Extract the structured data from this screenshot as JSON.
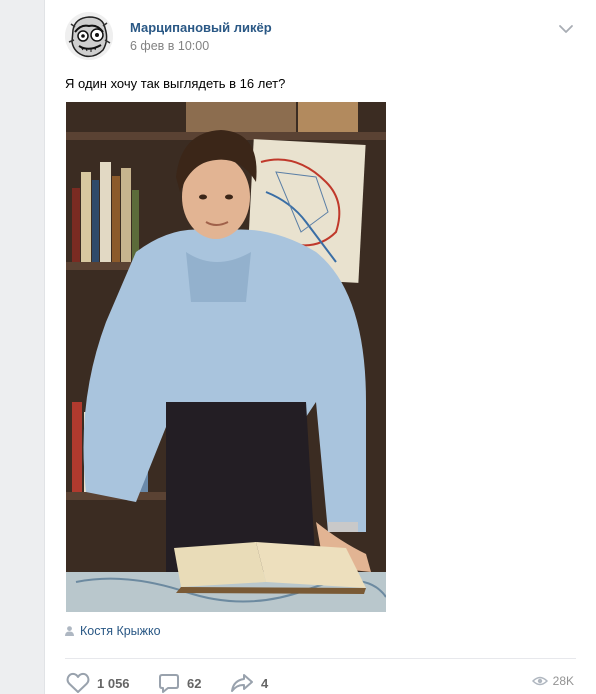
{
  "post": {
    "author": "Марципановый ликёр",
    "date": "6 фев в 10:00",
    "text": "Я один хочу так выглядеть в 16 лет?",
    "signer": "Костя Крыжко"
  },
  "actions": {
    "likes": "1 056",
    "comments": "62",
    "shares": "4",
    "views": "28K"
  },
  "icons": {
    "menu": "chevron-down-icon",
    "signer": "user-icon",
    "like": "heart-icon",
    "comment": "comment-icon",
    "share": "share-arrow-icon",
    "views": "eye-icon"
  },
  "colors": {
    "link": "#2a5885",
    "muted": "#828282",
    "page_bg": "#edeef0"
  }
}
